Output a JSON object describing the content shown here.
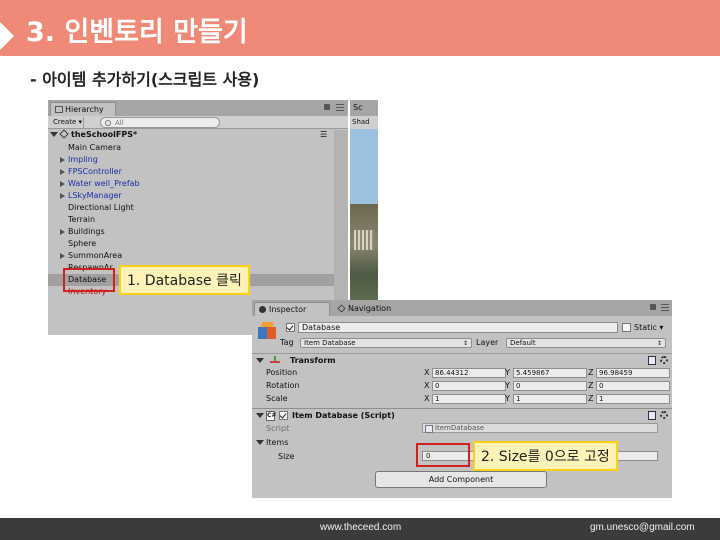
{
  "title": "3. 인벤토리 만들기",
  "subtitle": "- 아이템 추가하기(스크립트 사용)",
  "footer": {
    "site": "www.theceed.com",
    "email": "gm.unesco@gmail.com"
  },
  "hierarchy": {
    "tab": "Hierarchy",
    "create": "Create",
    "search_placeholder": "All",
    "scene": "theSchoolFPS*",
    "items": [
      {
        "label": "Main Camera",
        "blue": false,
        "arrow": false
      },
      {
        "label": "Impling",
        "blue": true,
        "arrow": true
      },
      {
        "label": "FPSController",
        "blue": true,
        "arrow": true
      },
      {
        "label": "Water well_Prefab",
        "blue": true,
        "arrow": true
      },
      {
        "label": "LSkyManager",
        "blue": true,
        "arrow": true
      },
      {
        "label": "Directional Light",
        "blue": false,
        "arrow": false
      },
      {
        "label": "Terrain",
        "blue": false,
        "arrow": false
      },
      {
        "label": "Buildings",
        "blue": false,
        "arrow": true
      },
      {
        "label": "Sphere",
        "blue": false,
        "arrow": false
      },
      {
        "label": "SummonArea",
        "blue": false,
        "arrow": true
      },
      {
        "label": "RespawnAr",
        "blue": false,
        "arrow": false
      },
      {
        "label": "Database",
        "blue": false,
        "arrow": false
      },
      {
        "label": "Inventory",
        "blue": false,
        "arrow": false
      }
    ]
  },
  "scene_view": {
    "tab": "Sc",
    "toolbar": "Shad"
  },
  "inspector": {
    "tab_inspector": "Inspector",
    "tab_navigation": "Navigation",
    "object_name": "Database",
    "static_label": "Static",
    "tag_label": "Tag",
    "tag_value": "Item Database",
    "layer_label": "Layer",
    "layer_value": "Default",
    "transform": {
      "title": "Transform",
      "rows": [
        {
          "name": "Position",
          "x": "86.44312",
          "y": "5.459867",
          "z": "96.98459"
        },
        {
          "name": "Rotation",
          "x": "0",
          "y": "0",
          "z": "0"
        },
        {
          "name": "Scale",
          "x": "1",
          "y": "1",
          "z": "1"
        }
      ]
    },
    "script_component": {
      "title": "Item Database (Script)",
      "script_label": "Script",
      "script_value": "itemDatabase",
      "items_label": "Items",
      "size_label": "Size",
      "size_value": "0"
    },
    "add_component": "Add Component"
  },
  "callouts": {
    "step1": "1. Database 클릭",
    "step2": "2. Size를 0으로 고정"
  },
  "colors": {
    "banner": "#ee8a77",
    "callout_bg": "#fff3b8",
    "callout_border": "#ffd21a",
    "highlight": "#d02020"
  }
}
